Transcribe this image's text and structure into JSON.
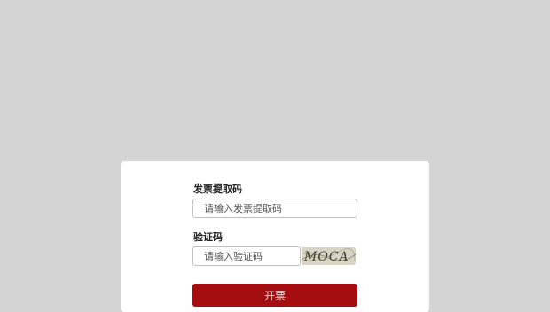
{
  "form": {
    "code_label": "发票提取码",
    "code_placeholder": "请输入发票提取码",
    "captcha_label": "验证码",
    "captcha_placeholder": "请输入验证码",
    "captcha_text": "MOCA",
    "submit_label": "开票"
  },
  "colors": {
    "background": "#d4d4d4",
    "card": "#ffffff",
    "button": "#a50e11",
    "button_text": "#f4dcdc"
  }
}
